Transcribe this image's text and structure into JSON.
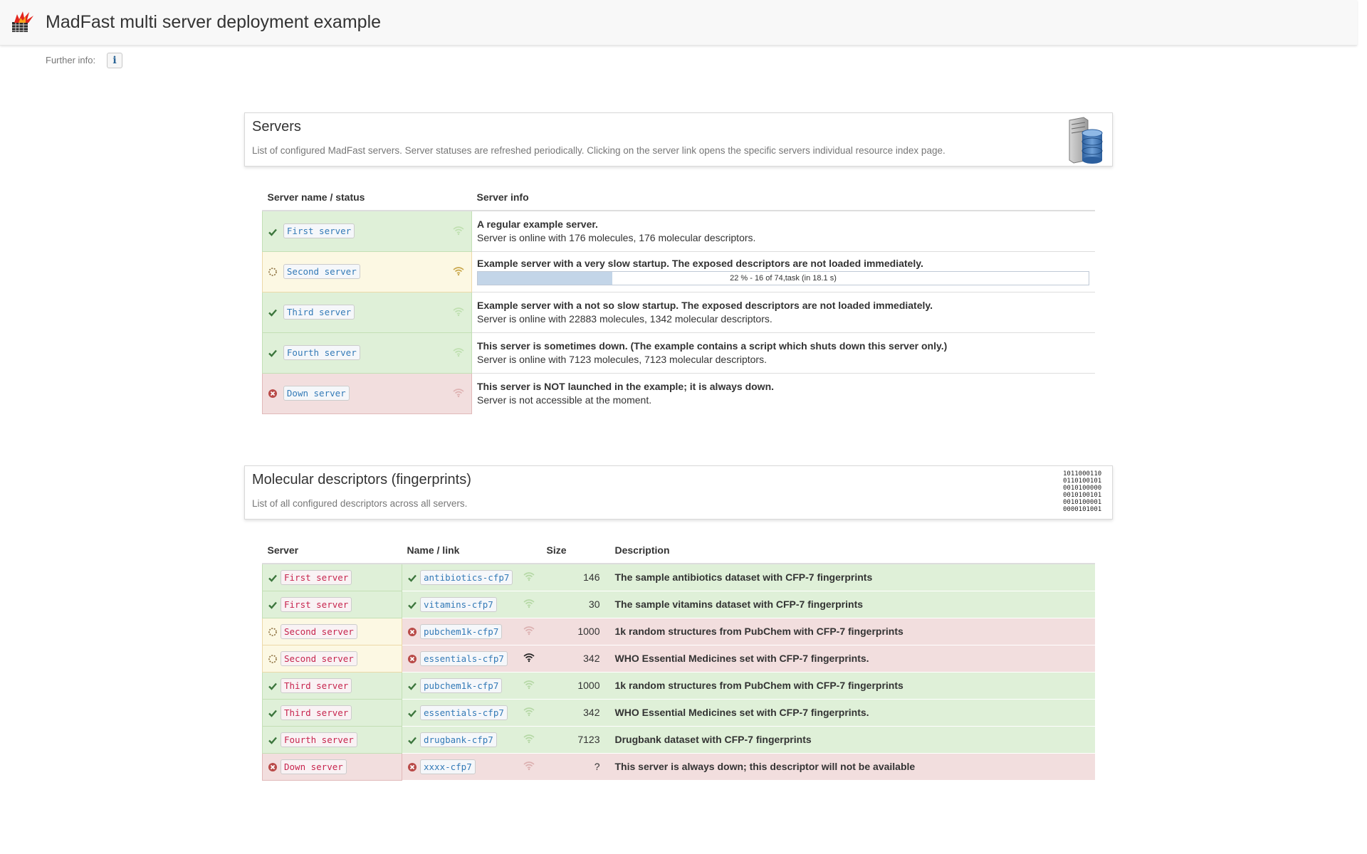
{
  "header": {
    "title": "MadFast multi server deployment example",
    "further_info_label": "Further info:",
    "info_button_glyph": "i"
  },
  "servers_panel": {
    "title": "Servers",
    "description": "List of configured MadFast servers. Server statuses are refreshed periodically. Clicking on the server link opens the specific servers individual resource index page.",
    "icon": "server-database-icon"
  },
  "servers_table": {
    "headers": [
      "Server name / status",
      "Server info"
    ],
    "rows": [
      {
        "status": "ok",
        "name": "First server",
        "info_title": "A regular example server.",
        "info_text": "Server is online with 176 molecules, 176 molecular descriptors."
      },
      {
        "status": "loading",
        "name": "Second server",
        "info_title": "Example server with a very slow startup. The exposed descriptors are not loaded immediately.",
        "progress_fraction": 0.22,
        "progress_text": "22 % - 16 of 74,task (in 18.1 s)"
      },
      {
        "status": "ok",
        "name": "Third server",
        "info_title": "Example server with a not so slow startup. The exposed descriptors are not loaded immediately.",
        "info_text": "Server is online with 22883 molecules, 1342 molecular descriptors."
      },
      {
        "status": "ok",
        "name": "Fourth server",
        "info_title": "This server is sometimes down. (The example contains a script which shuts down this server only.)",
        "info_text": "Server is online with 7123 molecules, 7123 molecular descriptors."
      },
      {
        "status": "error",
        "name": "Down server",
        "info_title": "This server is NOT launched in the example; it is always down.",
        "info_text": "Server is not accessible at the moment."
      }
    ]
  },
  "descriptors_panel": {
    "title": "Molecular descriptors (fingerprints)",
    "description": "List of all configured descriptors across all servers.",
    "icon": "binary-fingerprint-icon"
  },
  "descriptors_table": {
    "headers": [
      "Server",
      "Name / link",
      "Size",
      "Description"
    ],
    "rows": [
      {
        "server": "First server",
        "server_status": "ok",
        "name": "antibiotics-cfp7",
        "name_status": "ok",
        "size": "146",
        "description": "The sample antibiotics dataset with CFP-7 fingerprints"
      },
      {
        "server": "First server",
        "server_status": "ok",
        "name": "vitamins-cfp7",
        "name_status": "ok",
        "size": "30",
        "description": "The sample vitamins dataset with CFP-7 fingerprints"
      },
      {
        "server": "Second server",
        "server_status": "loading",
        "name": "pubchem1k-cfp7",
        "name_status": "error",
        "size": "1000",
        "description": "1k random structures from PubChem with CFP-7 fingerprints"
      },
      {
        "server": "Second server",
        "server_status": "loading",
        "name": "essentials-cfp7",
        "name_status": "error",
        "size": "342",
        "description": "WHO Essential Medicines set with CFP-7 fingerprints.",
        "wifi_active": true
      },
      {
        "server": "Third server",
        "server_status": "ok",
        "name": "pubchem1k-cfp7",
        "name_status": "ok",
        "size": "1000",
        "description": "1k random structures from PubChem with CFP-7 fingerprints"
      },
      {
        "server": "Third server",
        "server_status": "ok",
        "name": "essentials-cfp7",
        "name_status": "ok",
        "size": "342",
        "description": "WHO Essential Medicines set with CFP-7 fingerprints."
      },
      {
        "server": "Fourth server",
        "server_status": "ok",
        "name": "drugbank-cfp7",
        "name_status": "ok",
        "size": "7123",
        "description": "Drugbank dataset with CFP-7 fingerprints"
      },
      {
        "server": "Down server",
        "server_status": "error",
        "name": "xxxx-cfp7",
        "name_status": "error",
        "size": "?",
        "description": "This server is always down; this descriptor will not be available"
      }
    ]
  },
  "colors": {
    "ok_bg": "#dff0d8",
    "warn_bg": "#fcf8e3",
    "error_bg": "#f2dede",
    "ok_icon": "#3c763d",
    "error_icon": "#b94a48",
    "link_blue": "#337ab7",
    "code_red": "#c7254e"
  }
}
